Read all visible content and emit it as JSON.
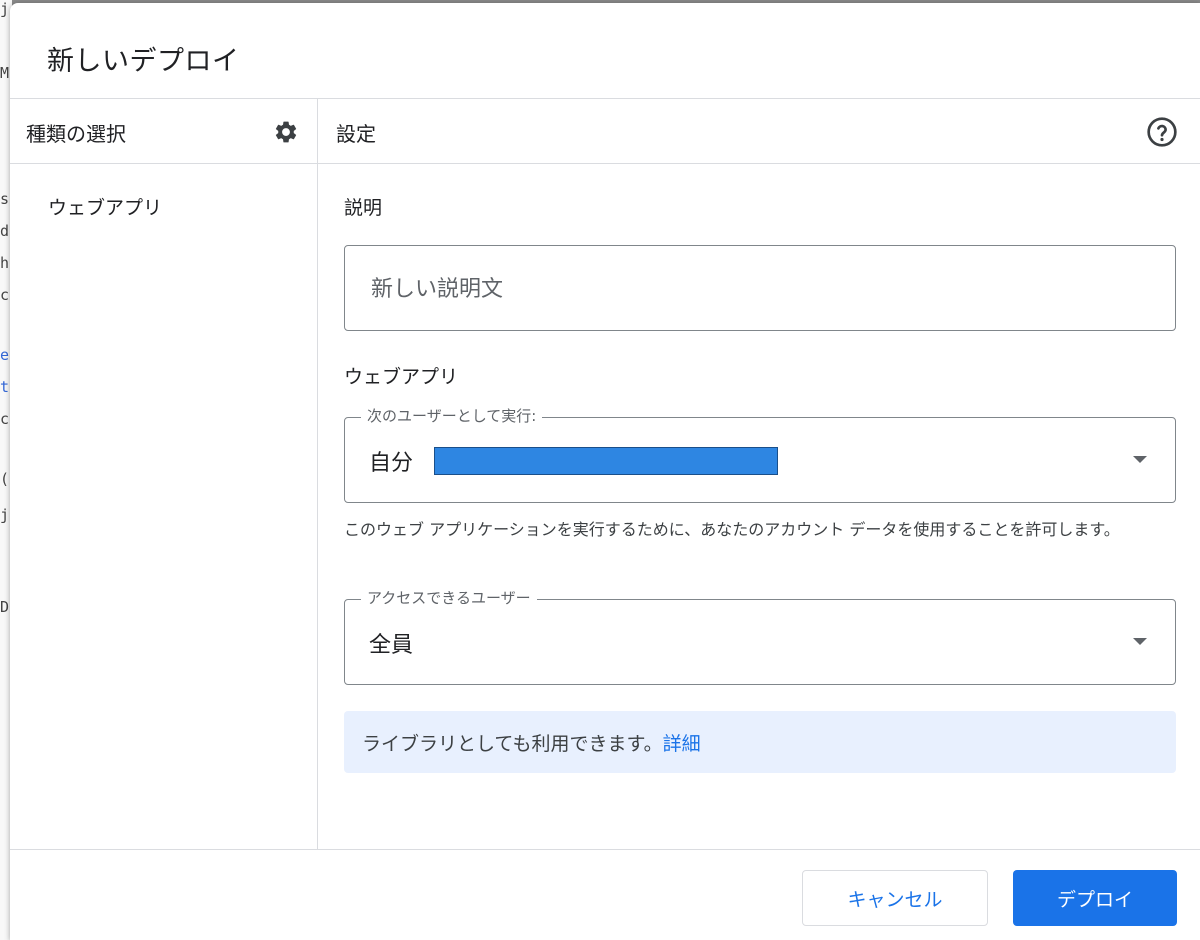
{
  "background_code": [
    "j",
    "M",
    "s",
    "d",
    "h",
    "c",
    "e",
    "t",
    "c",
    "(",
    "j",
    "D"
  ],
  "dialog": {
    "title": "新しいデプロイ"
  },
  "sidebar": {
    "title": "種類の選択",
    "gear_icon": "gear-icon",
    "items": [
      {
        "label": "ウェブアプリ"
      }
    ]
  },
  "main": {
    "title": "設定",
    "help_icon": "help-circle-icon",
    "description": {
      "label": "説明",
      "placeholder": "新しい説明文",
      "value": ""
    },
    "webapp": {
      "label": "ウェブアプリ",
      "execute_as": {
        "legend": "次のユーザーとして実行:",
        "value": "自分",
        "redacted_color": "#2e86e2"
      },
      "helper_text": "このウェブ アプリケーションを実行するために、あなたのアカウント データを使用することを許可します。",
      "access": {
        "legend": "アクセスできるユーザー",
        "value": "全員"
      }
    },
    "info": {
      "text": "ライブラリとしても利用できます。",
      "link": "詳細"
    }
  },
  "footer": {
    "cancel_label": "キャンセル",
    "deploy_label": "デプロイ"
  },
  "colors": {
    "accent": "#1a73e8",
    "info_bg": "#e8f0fe",
    "border": "#dadce0"
  }
}
